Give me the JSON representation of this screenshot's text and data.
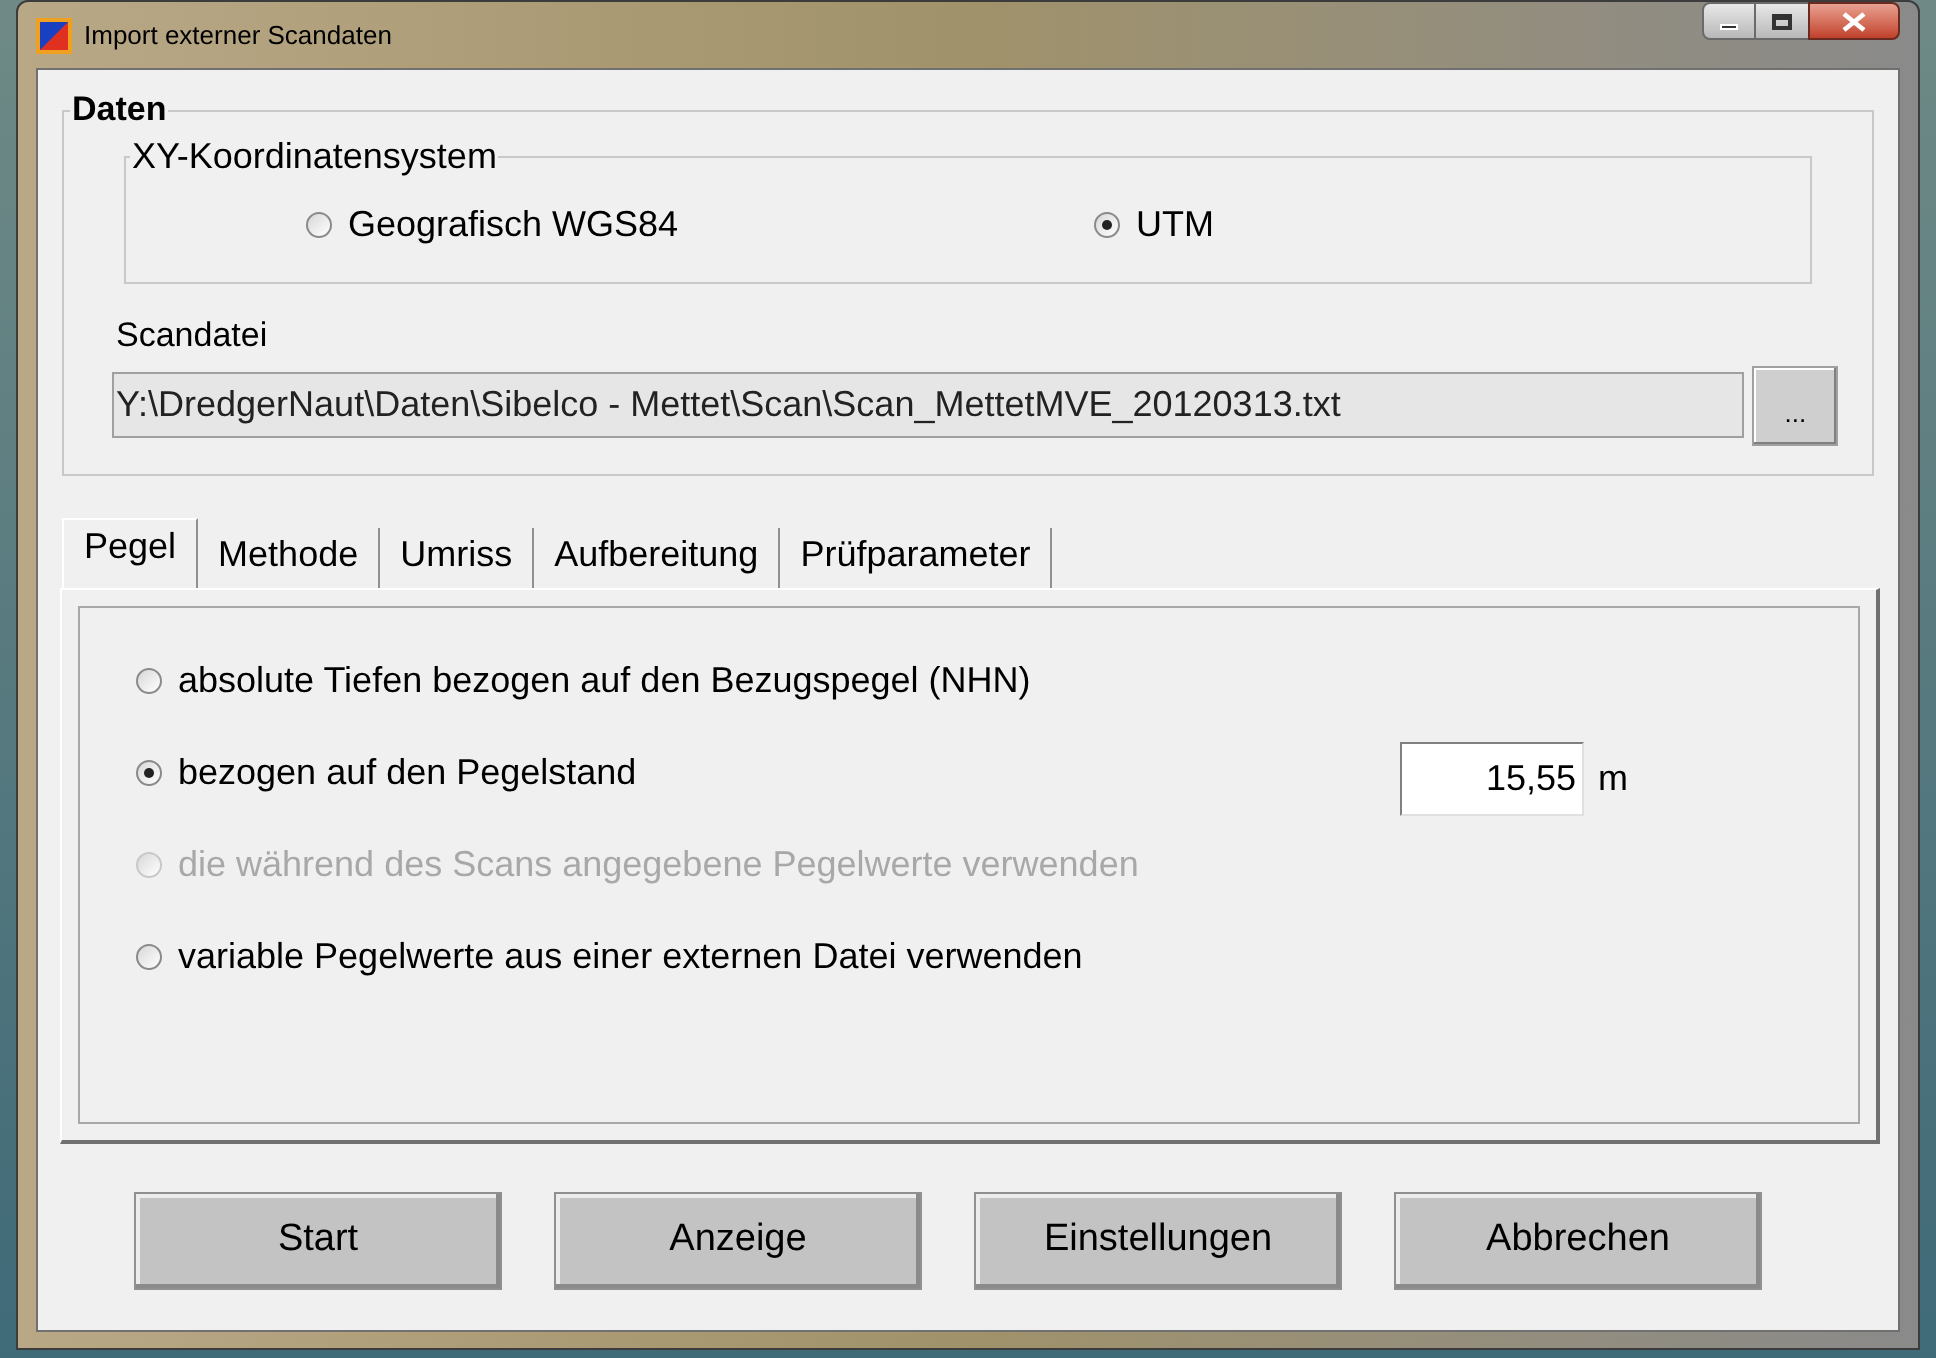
{
  "window": {
    "title": "Import externer Scandaten",
    "controls": [
      {
        "kind": "minimize"
      },
      {
        "kind": "maximize"
      },
      {
        "kind": "close"
      }
    ]
  },
  "daten": {
    "title": "Daten",
    "coordinate_system": {
      "title": "XY-Koordinatensystem",
      "options": [
        {
          "label": "Geografisch WGS84",
          "selected": false
        },
        {
          "label": "UTM",
          "selected": true
        }
      ]
    },
    "scan_file": {
      "label": "Scandatei",
      "value": "Y:\\DredgerNaut\\Daten\\Sibelco - Mettet\\Scan\\Scan_MettetMVE_20120313.txt",
      "browse": "..."
    }
  },
  "tabs": [
    {
      "label": "Pegel",
      "selected": true
    },
    {
      "label": "Methode",
      "selected": false
    },
    {
      "label": "Umriss",
      "selected": false
    },
    {
      "label": "Aufbereitung",
      "selected": false
    },
    {
      "label": "Prüfparameter",
      "selected": false
    }
  ],
  "pegel_options": [
    {
      "label": "absolute Tiefen bezogen auf den Bezugspegel (NHN)",
      "selected": false,
      "disabled": false
    },
    {
      "label": "bezogen auf den Pegelstand",
      "selected": true,
      "disabled": false,
      "value": "15,55",
      "unit": "m"
    },
    {
      "label": "die während des Scans angegebene Pegelwerte verwenden",
      "selected": false,
      "disabled": true
    },
    {
      "label": "variable Pegelwerte aus einer externen Datei verwenden",
      "selected": false,
      "disabled": false
    }
  ],
  "buttons": [
    "Start",
    "Anzeige",
    "Einstellungen",
    "Abbrechen"
  ]
}
